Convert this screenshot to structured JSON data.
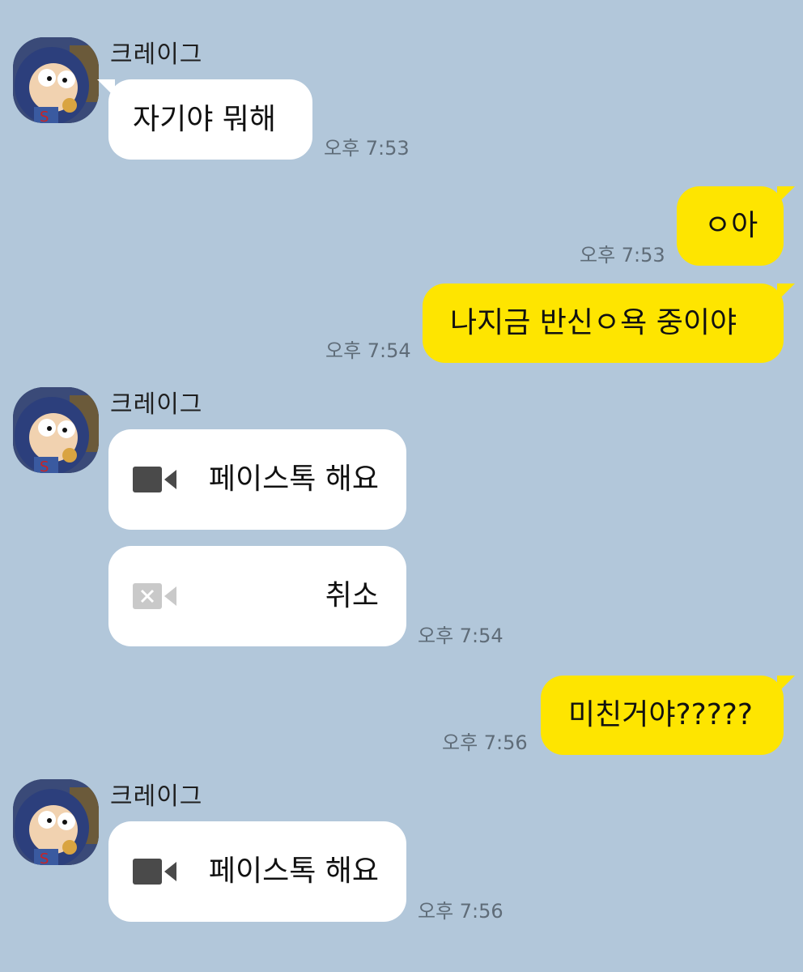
{
  "contact": {
    "name": "크레이그"
  },
  "messages": [
    {
      "from": "them",
      "text": "자기야 뭐해",
      "time": "오후 7:53"
    },
    {
      "from": "me",
      "text": "ㅇ아",
      "time": "오후 7:53"
    },
    {
      "from": "me",
      "text": "나지금 반신ㅇ욕 중이야",
      "time": "오후 7:54"
    },
    {
      "from": "them",
      "type": "facetalk",
      "text": "페이스톡 해요",
      "icon": "video-camera-icon"
    },
    {
      "from": "them",
      "type": "facetalk-cancel",
      "text": "취소",
      "icon": "video-camera-cancel-icon",
      "time": "오후 7:54"
    },
    {
      "from": "me",
      "text": "미친거야?????",
      "time": "오후 7:56"
    },
    {
      "from": "them",
      "type": "facetalk",
      "text": "페이스톡 해요",
      "icon": "video-camera-icon",
      "time": "오후 7:56"
    }
  ],
  "colors": {
    "background": "#b2c7da",
    "my_bubble": "#fee500",
    "their_bubble": "#ffffff",
    "timestamp": "#5f6c78"
  }
}
